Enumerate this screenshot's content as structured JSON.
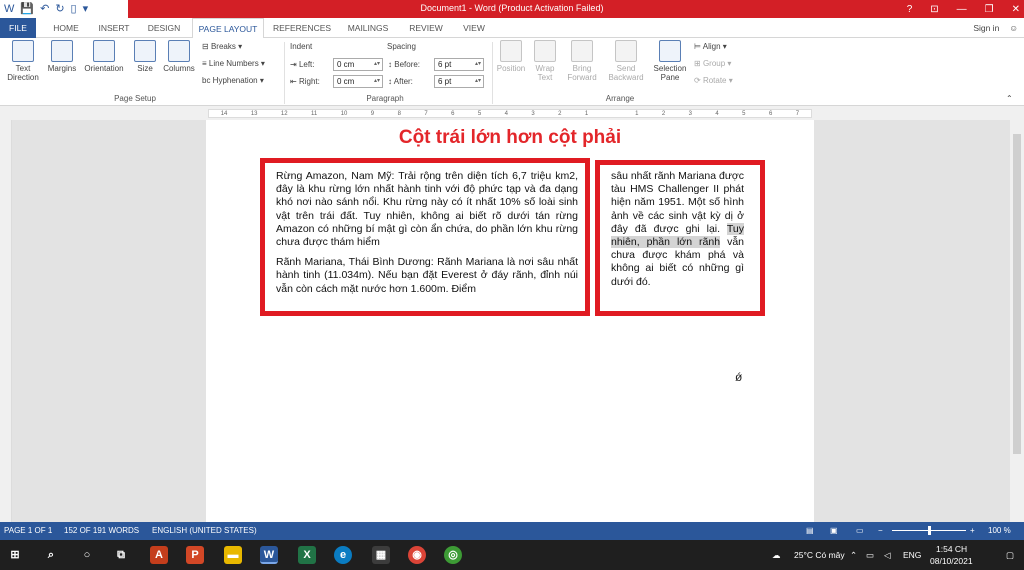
{
  "title_bar": {
    "title": "Document1 - Word (Product Activation Failed)",
    "controls": [
      "?",
      "⊡",
      "—",
      "❐",
      "✕"
    ]
  },
  "tabs": [
    {
      "label": "FILE"
    },
    {
      "label": "HOME"
    },
    {
      "label": "INSERT"
    },
    {
      "label": "DESIGN"
    },
    {
      "label": "PAGE LAYOUT"
    },
    {
      "label": "REFERENCES"
    },
    {
      "label": "MAILINGS"
    },
    {
      "label": "REVIEW"
    },
    {
      "label": "VIEW"
    }
  ],
  "sign_in": "Sign in",
  "ribbon": {
    "page_setup": {
      "label": "Page Setup",
      "text_direction": "Text Direction",
      "margins": "Margins",
      "orientation": "Orientation",
      "size": "Size",
      "columns": "Columns",
      "breaks": "Breaks",
      "line_numbers": "Line Numbers",
      "hyphenation": "Hyphenation"
    },
    "paragraph": {
      "label": "Paragraph",
      "indent": "Indent",
      "spacing": "Spacing",
      "left_label": "Left:",
      "right_label": "Right:",
      "before_label": "Before:",
      "after_label": "After:",
      "left_value": "0 cm",
      "right_value": "0 cm",
      "before_value": "6 pt",
      "after_value": "6 pt"
    },
    "arrange": {
      "label": "Arrange",
      "position": "Position",
      "wrap_text": "Wrap Text",
      "bring_forward": "Bring Forward",
      "send_backward": "Send Backward",
      "selection_pane": "Selection Pane",
      "align": "Align",
      "group": "Group",
      "rotate": "Rotate"
    }
  },
  "ruler": {
    "ticks": [
      "14",
      "13",
      "12",
      "11",
      "10",
      "9",
      "8",
      "7",
      "6",
      "5",
      "4",
      "3",
      "2",
      "1",
      "",
      "1",
      "2",
      "3",
      "4",
      "5",
      "6",
      "7"
    ]
  },
  "document": {
    "heading": "Cột trái lớn hơn cột phải",
    "left_column": [
      "Rừng Amazon, Nam Mỹ: Trải rộng trên diện tích 6,7 triệu km2, đây là khu rừng lớn nhất hành tinh với độ phức tạp và đa dạng khó nơi nào sánh nổi. Khu rừng này có ít nhất 10% số loài sinh vật trên trái đất. Tuy nhiên, không ai biết rõ dưới tán rừng Amazon có những bí mật gì còn ẩn chứa, do phần lớn khu rừng chưa được thám hiểm",
      "Rãnh Mariana, Thái Bình Dương: Rãnh Mariana là nơi sâu nhất hành tinh (11.034m). Nếu bạn đặt Everest ở đáy rãnh, đỉnh núi vẫn còn cách mặt nước hơn 1.600m. Điểm"
    ],
    "right_column_text": "sâu nhất rãnh Mariana được tàu HMS Challenger II phát hiện năm 1951. Một số hình ảnh về các sinh vật kỳ dị ở đây đã được ghi lại.",
    "right_column_highlight": "Tuy nhiên, phần lớn rãnh",
    "right_column_rest": "vẫn chưa được khám phá và không ai biết có những gì dưới đó."
  },
  "status_bar": {
    "page": "PAGE 1 OF 1",
    "words": "152 OF 191 WORDS",
    "language": "ENGLISH (UNITED STATES)",
    "zoom": "100 %",
    "zoom_minus": "−",
    "zoom_plus": "+"
  },
  "taskbar": {
    "weather": "25°C  Có mây",
    "lang": "ENG",
    "time": "1:54 CH",
    "date": "08/10/2021"
  },
  "colors": {
    "title_bar": "#d31f26",
    "accent": "#2b579a",
    "box_border": "#e01b22",
    "heading": "#e3262a"
  }
}
